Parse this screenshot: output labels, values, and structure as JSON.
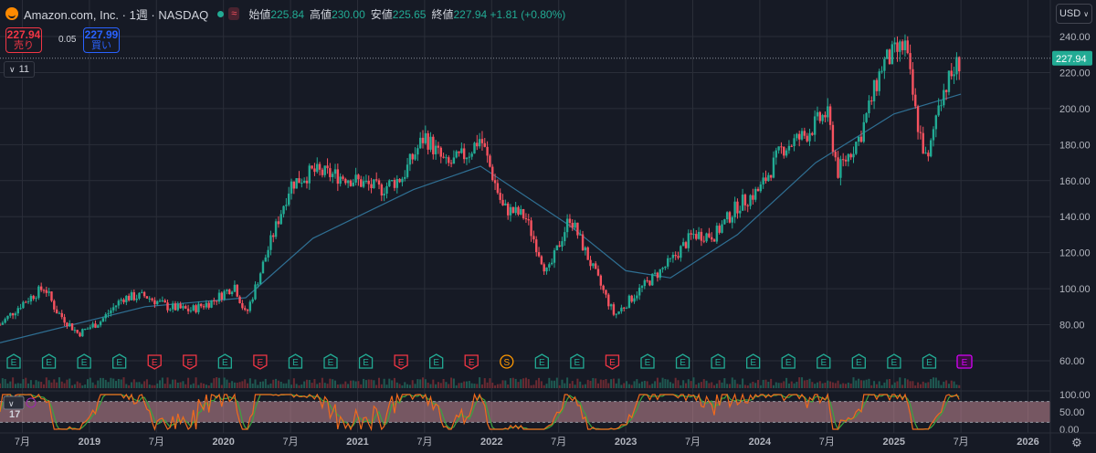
{
  "header": {
    "symbol_title": "Amazon.com, Inc. · 1週 · NASDAQ",
    "ohlc": {
      "open_label": "始値",
      "open": "225.84",
      "high_label": "高値",
      "high": "230.00",
      "low_label": "安値",
      "low": "225.65",
      "close_label": "終値",
      "close": "227.94",
      "change": "+1.81 (+0.80%)"
    }
  },
  "trade": {
    "sell_price": "227.94",
    "sell_label": "売り",
    "spread": "0.05",
    "buy_price": "227.99",
    "buy_label": "買い"
  },
  "indicators_toggle": {
    "count": "11"
  },
  "currency": "USD",
  "price_scale": {
    "ticks": [
      "240.00",
      "220.00",
      "200.00",
      "180.00",
      "160.00",
      "140.00",
      "120.00",
      "100.00",
      "80.00",
      "60.00"
    ],
    "last_price": "227.94",
    "osc_ticks": [
      "100.00",
      "50.00",
      "0.00"
    ]
  },
  "time_scale": [
    "7月",
    "2019",
    "7月",
    "2020",
    "7月",
    "2021",
    "7月",
    "2022",
    "7月",
    "2023",
    "7月",
    "2024",
    "7月",
    "2025",
    "7月",
    "2026"
  ],
  "event_markers": [
    {
      "label": "E",
      "type": "positive"
    },
    {
      "label": "E",
      "type": "positive"
    },
    {
      "label": "E",
      "type": "positive"
    },
    {
      "label": "E",
      "type": "positive"
    },
    {
      "label": "E",
      "type": "negative"
    },
    {
      "label": "E",
      "type": "negative"
    },
    {
      "label": "E",
      "type": "positive"
    },
    {
      "label": "E",
      "type": "negative"
    },
    {
      "label": "E",
      "type": "positive"
    },
    {
      "label": "E",
      "type": "positive"
    },
    {
      "label": "E",
      "type": "positive"
    },
    {
      "label": "E",
      "type": "negative"
    },
    {
      "label": "E",
      "type": "positive"
    },
    {
      "label": "E",
      "type": "negative"
    },
    {
      "label": "S",
      "type": "split"
    },
    {
      "label": "E",
      "type": "positive"
    },
    {
      "label": "E",
      "type": "positive"
    },
    {
      "label": "E",
      "type": "negative"
    },
    {
      "label": "E",
      "type": "positive"
    },
    {
      "label": "E",
      "type": "positive"
    },
    {
      "label": "E",
      "type": "positive"
    },
    {
      "label": "E",
      "type": "positive"
    },
    {
      "label": "E",
      "type": "positive"
    },
    {
      "label": "E",
      "type": "positive"
    },
    {
      "label": "E",
      "type": "positive"
    },
    {
      "label": "E",
      "type": "positive"
    },
    {
      "label": "E",
      "type": "positive"
    },
    {
      "label": "E",
      "type": "upcoming"
    }
  ],
  "colors": {
    "up": "#22ab94",
    "down": "#f7525f",
    "ma": "#2f6f93",
    "osc_k": "#f06a1c",
    "osc_d": "#3ba43f",
    "osc_band": "#c78b95",
    "background": "#161a25",
    "grid": "#2a2e39"
  },
  "chart_data": {
    "type": "candlestick",
    "interval": "1W",
    "time_range": [
      "2018-05",
      "2026-03"
    ],
    "ylim": [
      60,
      248
    ],
    "close_path": [
      {
        "t": "2018-05",
        "v": 80
      },
      {
        "t": "2018-07",
        "v": 92
      },
      {
        "t": "2018-09",
        "v": 101
      },
      {
        "t": "2018-10",
        "v": 88
      },
      {
        "t": "2018-12",
        "v": 75
      },
      {
        "t": "2019-02",
        "v": 82
      },
      {
        "t": "2019-04",
        "v": 95
      },
      {
        "t": "2019-06",
        "v": 96
      },
      {
        "t": "2019-08",
        "v": 90
      },
      {
        "t": "2019-10",
        "v": 88
      },
      {
        "t": "2019-12",
        "v": 93
      },
      {
        "t": "2020-02",
        "v": 102
      },
      {
        "t": "2020-03",
        "v": 85
      },
      {
        "t": "2020-05",
        "v": 122
      },
      {
        "t": "2020-07",
        "v": 158
      },
      {
        "t": "2020-09",
        "v": 165
      },
      {
        "t": "2020-12",
        "v": 162
      },
      {
        "t": "2021-03",
        "v": 155
      },
      {
        "t": "2021-05",
        "v": 162
      },
      {
        "t": "2021-07",
        "v": 185
      },
      {
        "t": "2021-09",
        "v": 168
      },
      {
        "t": "2021-11",
        "v": 176
      },
      {
        "t": "2021-12",
        "v": 184
      },
      {
        "t": "2022-02",
        "v": 145
      },
      {
        "t": "2022-04",
        "v": 140
      },
      {
        "t": "2022-06",
        "v": 108
      },
      {
        "t": "2022-08",
        "v": 140
      },
      {
        "t": "2022-10",
        "v": 112
      },
      {
        "t": "2022-12",
        "v": 85
      },
      {
        "t": "2023-02",
        "v": 98
      },
      {
        "t": "2023-05",
        "v": 115
      },
      {
        "t": "2023-07",
        "v": 130
      },
      {
        "t": "2023-09",
        "v": 130
      },
      {
        "t": "2023-11",
        "v": 146
      },
      {
        "t": "2024-01",
        "v": 155
      },
      {
        "t": "2024-03",
        "v": 178
      },
      {
        "t": "2024-05",
        "v": 185
      },
      {
        "t": "2024-07",
        "v": 198
      },
      {
        "t": "2024-08",
        "v": 165
      },
      {
        "t": "2024-10",
        "v": 185
      },
      {
        "t": "2024-12",
        "v": 225
      },
      {
        "t": "2025-02",
        "v": 235
      },
      {
        "t": "2025-03",
        "v": 195
      },
      {
        "t": "2025-04",
        "v": 168
      },
      {
        "t": "2025-05",
        "v": 205
      },
      {
        "t": "2025-07",
        "v": 228
      }
    ],
    "moving_average": [
      {
        "t": "2018-05",
        "v": 70
      },
      {
        "t": "2019-06",
        "v": 90
      },
      {
        "t": "2020-03",
        "v": 95
      },
      {
        "t": "2020-09",
        "v": 128
      },
      {
        "t": "2021-06",
        "v": 155
      },
      {
        "t": "2021-12",
        "v": 168
      },
      {
        "t": "2022-08",
        "v": 135
      },
      {
        "t": "2023-01",
        "v": 110
      },
      {
        "t": "2023-05",
        "v": 106
      },
      {
        "t": "2023-11",
        "v": 130
      },
      {
        "t": "2024-06",
        "v": 170
      },
      {
        "t": "2025-01",
        "v": 197
      },
      {
        "t": "2025-07",
        "v": 208
      }
    ],
    "last_price": 227.94,
    "oscillator": {
      "ylim": [
        0,
        100
      ],
      "band": [
        20,
        80
      ]
    }
  }
}
